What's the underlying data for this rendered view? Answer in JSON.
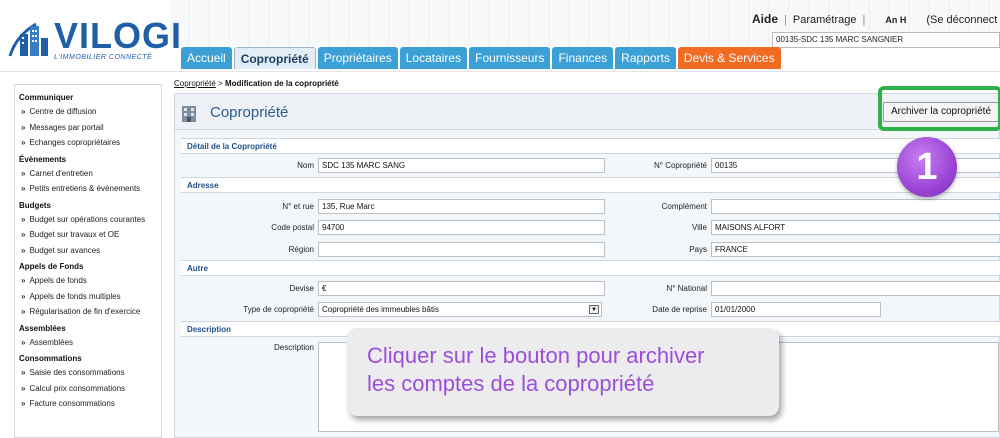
{
  "brand": {
    "name": "VILOGI",
    "tagline": "L'IMMOBILIER CONNECTÉ",
    "color": "#1f5fa7"
  },
  "toplinks": {
    "help": "Aide",
    "settings": "Paramétrage",
    "user": "An H",
    "logout": "(Se déconnect"
  },
  "copro_select": {
    "value": "00135-SDC 135 MARC SANGNIER"
  },
  "nav": {
    "tabs": [
      {
        "label": "Accueil",
        "active": false
      },
      {
        "label": "Copropriété",
        "active": true
      },
      {
        "label": "Propriétaires",
        "active": false
      },
      {
        "label": "Locataires",
        "active": false
      },
      {
        "label": "Fournisseurs",
        "active": false
      },
      {
        "label": "Finances",
        "active": false
      },
      {
        "label": "Rapports",
        "active": false
      },
      {
        "label": "Devis & Services",
        "active": false,
        "accent": "#f16b22"
      }
    ]
  },
  "sidebar": {
    "sections": [
      {
        "title": "Communiquer",
        "items": [
          "Centre de diffusion",
          "Messages par portail",
          "Echanges copropriétaires"
        ]
      },
      {
        "title": "Évènements",
        "items": [
          "Carnet d'entretien",
          "Petits entretiens & évènements"
        ]
      },
      {
        "title": "Budgets",
        "items": [
          "Budget sur opérations courantes",
          "Budget sur travaux et OE",
          "Budget sur avances"
        ]
      },
      {
        "title": "Appels de Fonds",
        "items": [
          "Appels de fonds",
          "Appels de fonds multiples",
          "Régularisation de fin d'exercice"
        ]
      },
      {
        "title": "Assemblées",
        "items": [
          "Assemblées"
        ]
      },
      {
        "title": "Consommations",
        "items": [
          "Saisie des consommations",
          "Calcul prix consommations",
          "Facture consommations"
        ]
      }
    ]
  },
  "breadcrumb": {
    "parent": "Copropriété",
    "separator": ">",
    "current": "Modification de la copropriété"
  },
  "panel": {
    "title": "Copropriété",
    "archive_button": "Archiver la copropriété"
  },
  "sections": {
    "detail": "Détail de la Copropriété",
    "adresse": "Adresse",
    "autre": "Autre",
    "description": "Description"
  },
  "fields": {
    "nom": {
      "label": "Nom",
      "value": "SDC 135 MARC SANG"
    },
    "num_copro": {
      "label": "N° Copropriété",
      "value": "00135"
    },
    "rue": {
      "label": "N° et rue",
      "value": "135, Rue Marc"
    },
    "complement": {
      "label": "Complément",
      "value": ""
    },
    "code_postal": {
      "label": "Code postal",
      "value": "94700"
    },
    "ville": {
      "label": "Ville",
      "value": "MAISONS ALFORT"
    },
    "region": {
      "label": "Région",
      "value": ""
    },
    "pays": {
      "label": "Pays",
      "value": "FRANCE"
    },
    "devise": {
      "label": "Devise",
      "value": "€"
    },
    "num_national": {
      "label": "N° National",
      "value": ""
    },
    "type": {
      "label": "Type de copropriété",
      "value": "Copropriété des immeubles bâtis"
    },
    "date_reprise": {
      "label": "Date de reprise",
      "value": "01/01/2000"
    },
    "description": {
      "label": "Description",
      "value": ""
    }
  },
  "annotation": {
    "step": "1",
    "line1": "Cliquer sur le bouton pour archiver",
    "line2": "les comptes de la copropriété",
    "highlight_color": "#2db24a",
    "badge_color": "#9b45d6"
  }
}
